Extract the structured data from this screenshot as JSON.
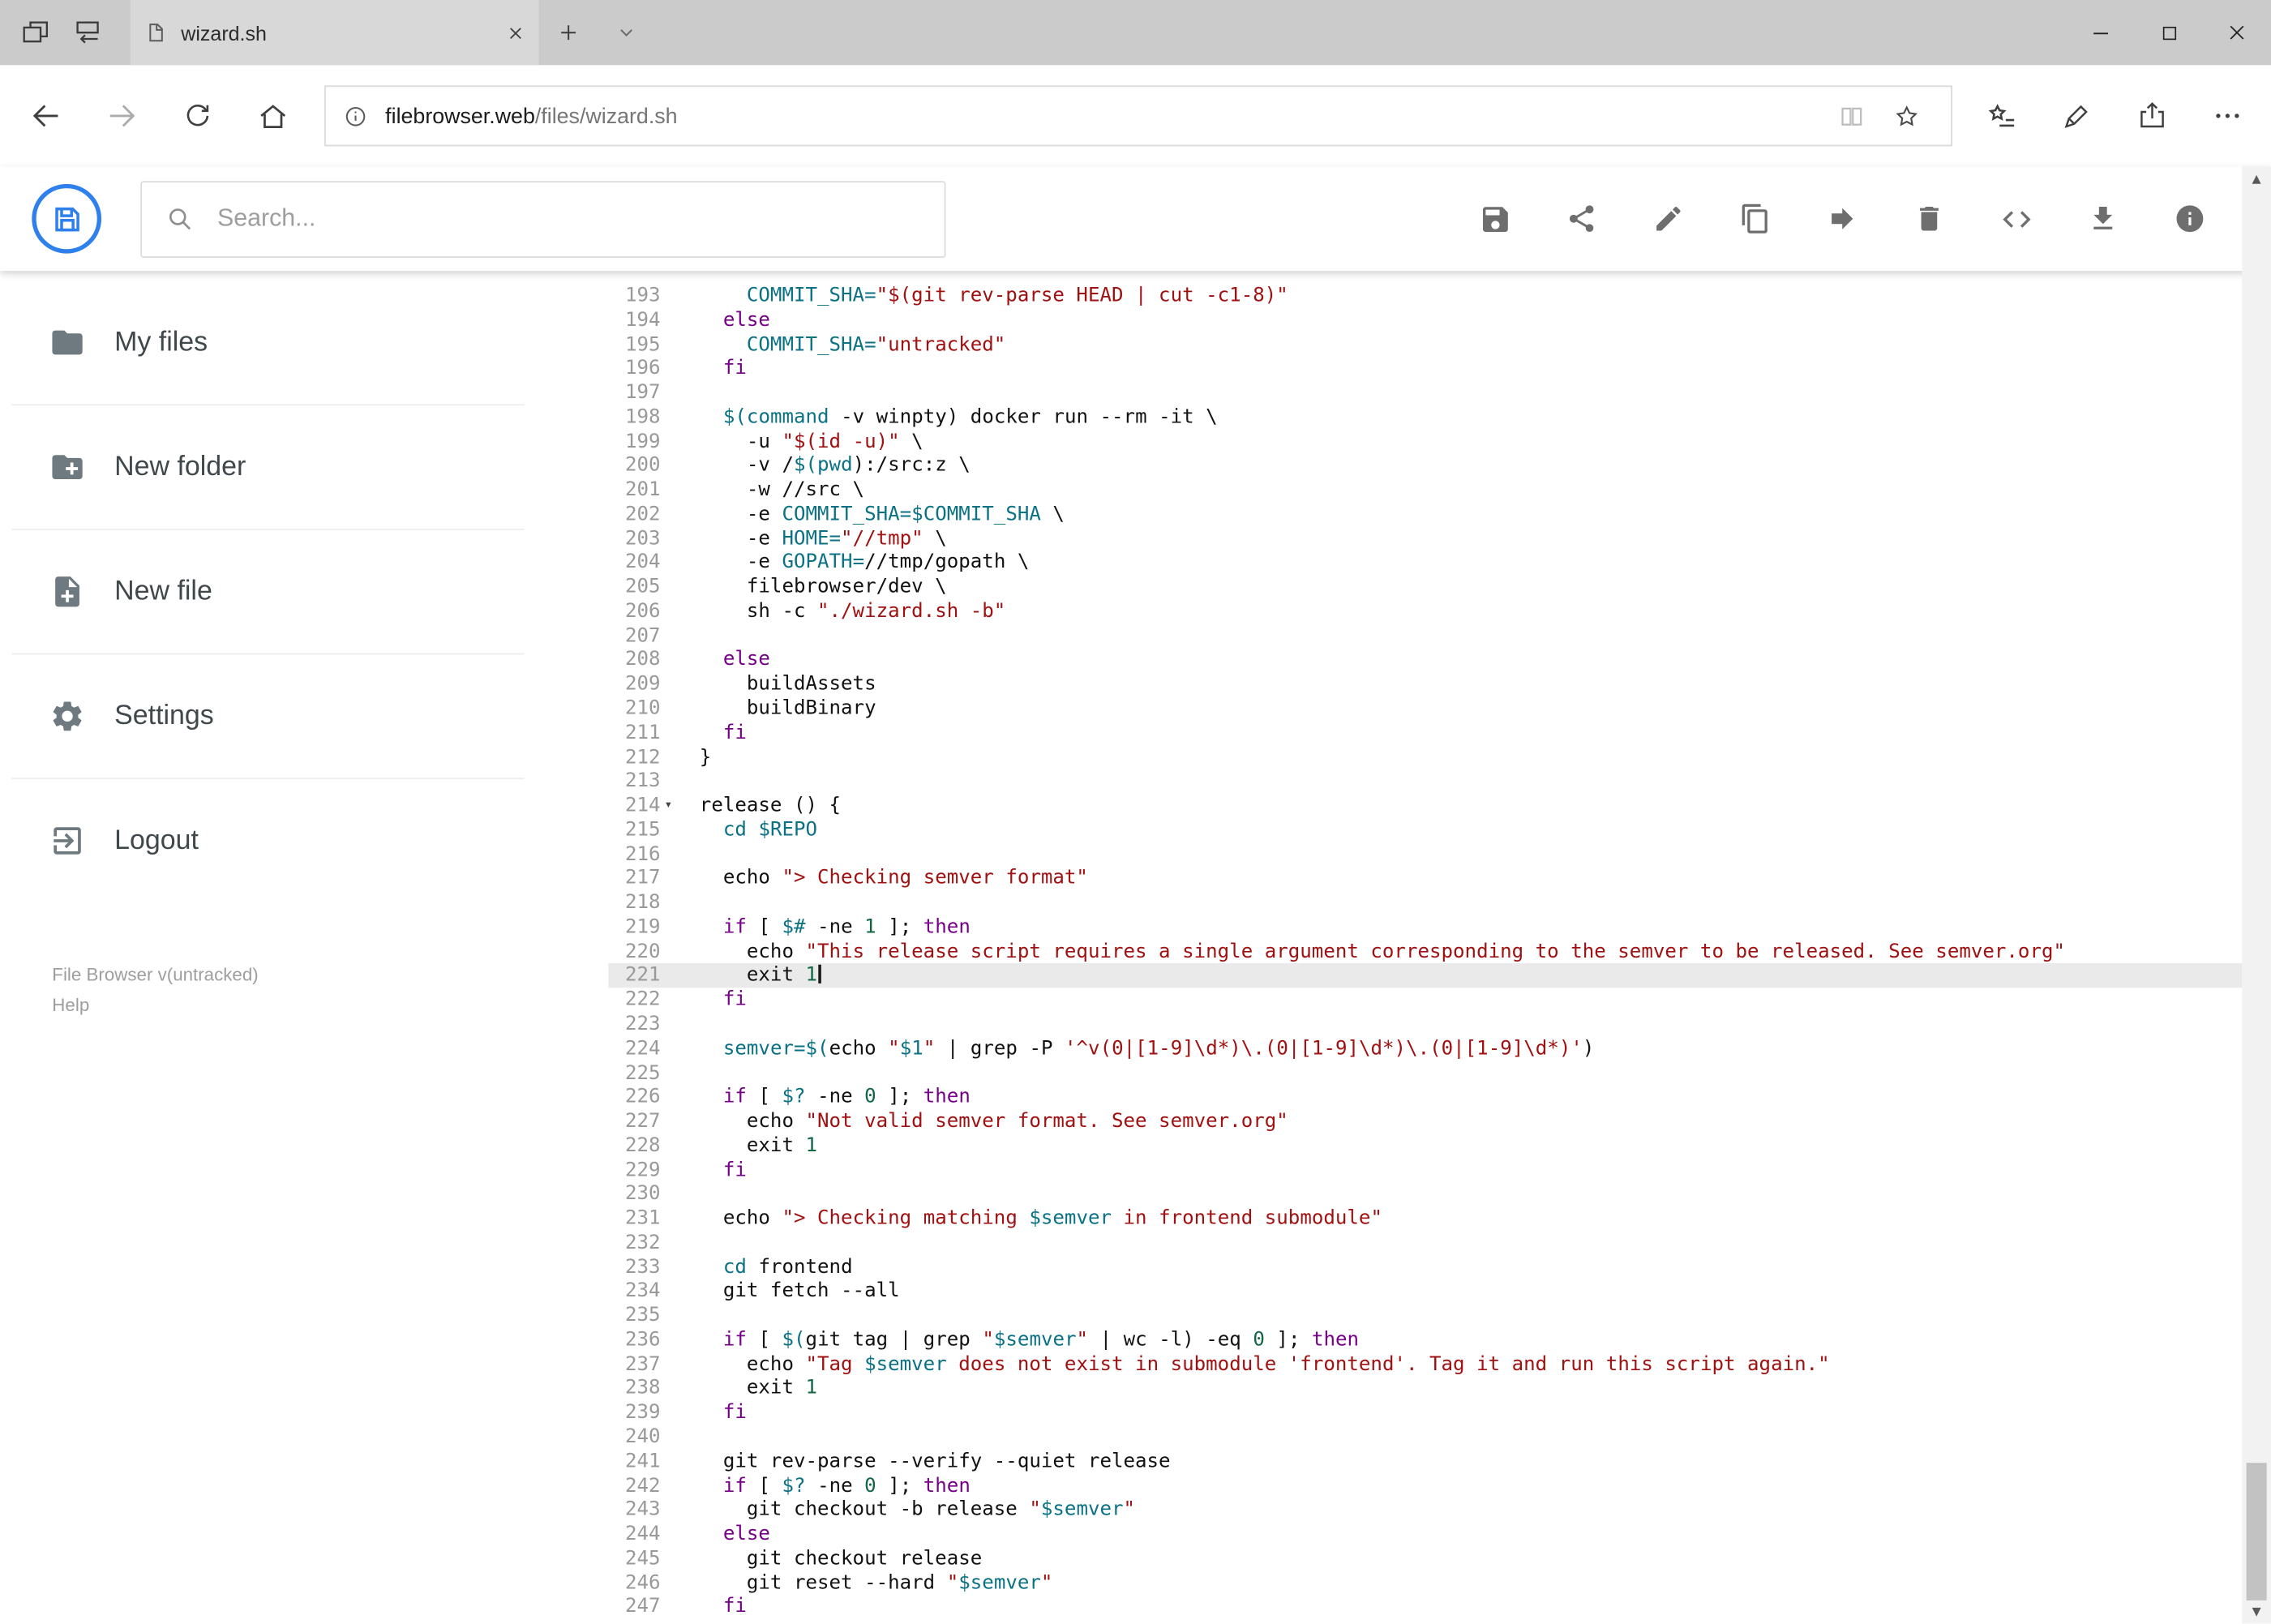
{
  "browser": {
    "tab_title": "wizard.sh",
    "url": {
      "host": "filebrowser.web",
      "path": "/files/wizard.sh"
    }
  },
  "app": {
    "search_placeholder": "Search...",
    "toolbar_icons": [
      "save",
      "share",
      "edit",
      "copy",
      "move",
      "delete",
      "code",
      "download",
      "info"
    ],
    "sidebar": {
      "items": [
        {
          "label": "My files",
          "icon": "folder"
        },
        {
          "label": "New folder",
          "icon": "folder-plus"
        },
        {
          "label": "New file",
          "icon": "file-plus"
        },
        {
          "label": "Settings",
          "icon": "gear"
        },
        {
          "label": "Logout",
          "icon": "logout"
        }
      ],
      "footer_version": "File Browser v(untracked)",
      "footer_help": "Help"
    }
  },
  "editor": {
    "first_line_number": 193,
    "active_line": 221,
    "fold_marker_line": 214,
    "lines": [
      "    COMMIT_SHA=\"$(git rev-parse HEAD | cut -c1-8)\"",
      "  else",
      "    COMMIT_SHA=\"untracked\"",
      "  fi",
      "",
      "  $(command -v winpty) docker run --rm -it \\",
      "    -u \"$(id -u)\" \\",
      "    -v /$(pwd):/src:z \\",
      "    -w //src \\",
      "    -e COMMIT_SHA=$COMMIT_SHA \\",
      "    -e HOME=\"//tmp\" \\",
      "    -e GOPATH=//tmp/gopath \\",
      "    filebrowser/dev \\",
      "    sh -c \"./wizard.sh -b\"",
      "",
      "  else",
      "    buildAssets",
      "    buildBinary",
      "  fi",
      "}",
      "",
      "release () {",
      "  cd $REPO",
      "",
      "  echo \"> Checking semver format\"",
      "",
      "  if [ $# -ne 1 ]; then",
      "    echo \"This release script requires a single argument corresponding to the semver to be released. See semver.org\"",
      "    exit 1",
      "  fi",
      "",
      "  semver=$(echo \"$1\" | grep -P '^v(0|[1-9]\\d*)\\.(0|[1-9]\\d*)\\.(0|[1-9]\\d*)')",
      "",
      "  if [ $? -ne 0 ]; then",
      "    echo \"Not valid semver format. See semver.org\"",
      "    exit 1",
      "  fi",
      "",
      "  echo \"> Checking matching $semver in frontend submodule\"",
      "",
      "  cd frontend",
      "  git fetch --all",
      "",
      "  if [ $(git tag | grep \"$semver\" | wc -l) -eq 0 ]; then",
      "    echo \"Tag $semver does not exist in submodule 'frontend'. Tag it and run this script again.\"",
      "    exit 1",
      "  fi",
      "",
      "  git rev-parse --verify --quiet release",
      "  if [ $? -ne 0 ]; then",
      "    git checkout -b release \"$semver\"",
      "  else",
      "    git checkout release",
      "    git reset --hard \"$semver\"",
      "  fi"
    ]
  },
  "colors": {
    "accent_blue": "#2f80ed",
    "titlebar_bg": "#cbcbcb",
    "active_tab_bg": "#d8d8d8",
    "active_line_bg": "#eaeaea",
    "syntax_keyword": "#770088",
    "syntax_string": "#a11111",
    "syntax_variable": "#0b7285",
    "syntax_number": "#116644",
    "gutter_text": "#999999"
  }
}
